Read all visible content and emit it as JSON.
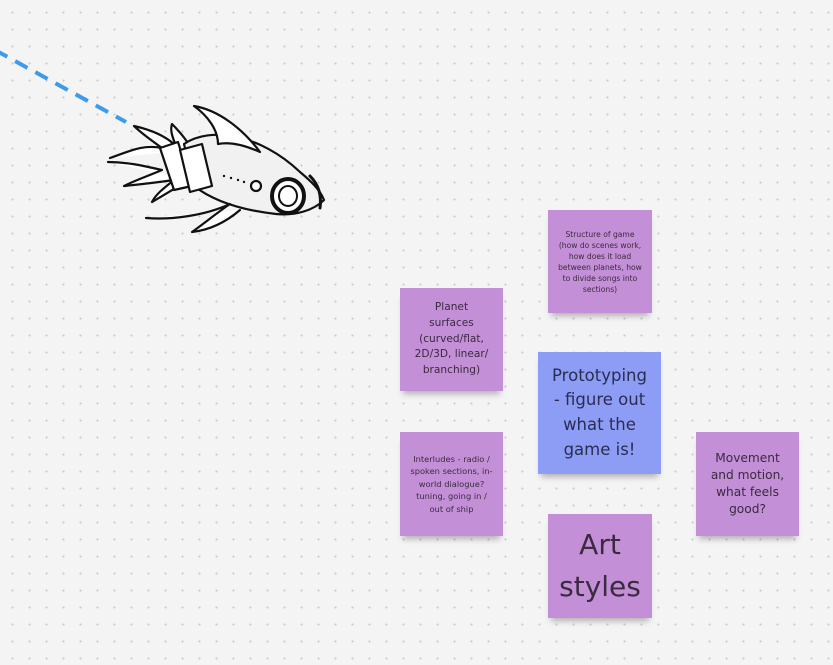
{
  "board": {
    "background_color": "#f4f4f4",
    "dot_color": "#c9c9c9",
    "connector_color": "#3d9be9",
    "connector_style": "dashed"
  },
  "illustration": {
    "icon": "rocket-icon"
  },
  "sticky_notes": [
    {
      "id": "structure",
      "text": "Structure of game (how do scenes work, how does it load between planets, how to divide songs into sections)",
      "color": "#c38fd6"
    },
    {
      "id": "planet",
      "text": "Planet surfaces (curved/flat, 2D/3D, linear/ branching)",
      "color": "#c38fd6"
    },
    {
      "id": "prototyping",
      "text": "Prototyping - figure out what the game is!",
      "color": "#8d9cf5"
    },
    {
      "id": "interludes",
      "text": "Interludes - radio / spoken sections, in-world dialogue? tuning, going in / out of ship",
      "color": "#c38fd6"
    },
    {
      "id": "movement",
      "text": "Movement and motion, what feels good?",
      "color": "#c38fd6"
    },
    {
      "id": "art",
      "text": "Art styles",
      "color": "#c38fd6"
    }
  ]
}
